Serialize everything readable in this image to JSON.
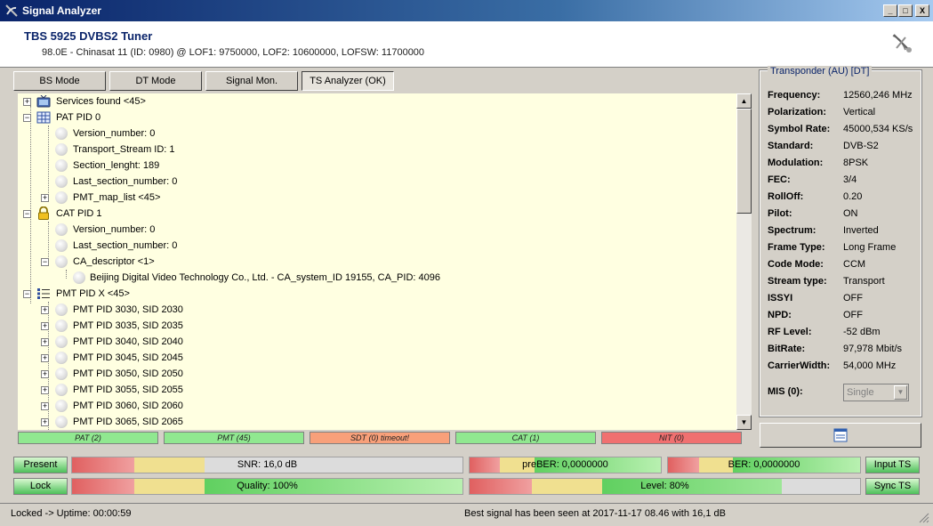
{
  "window": {
    "title": "Signal Analyzer",
    "min_glyph": "_",
    "max_glyph": "□",
    "close_glyph": "X"
  },
  "header": {
    "device": "TBS 5925 DVBS2 Tuner",
    "info": "98.0E - Chinasat 11 (ID: 0980) @ LOF1: 9750000, LOF2: 10600000, LOFSW: 11700000"
  },
  "modes": [
    {
      "label": "BS Mode"
    },
    {
      "label": "DT Mode"
    },
    {
      "label": "Signal Mon."
    },
    {
      "label": "TS Analyzer (OK)"
    }
  ],
  "tree": [
    {
      "label": "Services found <45>"
    },
    {
      "label": "PAT PID 0"
    },
    {
      "label": "Version_number: 0"
    },
    {
      "label": "Transport_Stream ID: 1"
    },
    {
      "label": "Section_lenght: 189"
    },
    {
      "label": "Last_section_number: 0"
    },
    {
      "label": "PMT_map_list <45>"
    },
    {
      "label": "CAT PID 1"
    },
    {
      "label": "Version_number: 0"
    },
    {
      "label": "Last_section_number: 0"
    },
    {
      "label": "CA_descriptor <1>"
    },
    {
      "label": "Beijing Digital Video Technology Co., Ltd. - CA_system_ID 19155, CA_PID: 4096"
    },
    {
      "label": "PMT PID X <45>"
    },
    {
      "label": "PMT PID 3030, SID 2030"
    },
    {
      "label": "PMT PID 3035, SID 2035"
    },
    {
      "label": "PMT PID 3040, SID 2040"
    },
    {
      "label": "PMT PID 3045, SID 2045"
    },
    {
      "label": "PMT PID 3050, SID 2050"
    },
    {
      "label": "PMT PID 3055, SID 2055"
    },
    {
      "label": "PMT PID 3060, SID 2060"
    },
    {
      "label": "PMT PID 3065, SID 2065"
    }
  ],
  "pid_status": [
    {
      "label": "PAT (2)",
      "color": "#90e890"
    },
    {
      "label": "PMT (45)",
      "color": "#90e890"
    },
    {
      "label": "SDT (0) timeout!",
      "color": "#f8a07a"
    },
    {
      "label": "CAT (1)",
      "color": "#90e890"
    },
    {
      "label": "NIT (0)",
      "color": "#f07070"
    }
  ],
  "transponder": {
    "title": "Transponder (AU) [DT]",
    "rows": [
      {
        "label": "Frequency:",
        "value": "12560,246 MHz"
      },
      {
        "label": "Polarization:",
        "value": "Vertical"
      },
      {
        "label": "Symbol Rate:",
        "value": "45000,534 KS/s"
      },
      {
        "label": "Standard:",
        "value": "DVB-S2"
      },
      {
        "label": "Modulation:",
        "value": "8PSK"
      },
      {
        "label": "FEC:",
        "value": "3/4"
      },
      {
        "label": "RollOff:",
        "value": "0.20"
      },
      {
        "label": "Pilot:",
        "value": "ON"
      },
      {
        "label": "Spectrum:",
        "value": "Inverted"
      },
      {
        "label": "Frame Type:",
        "value": "Long Frame"
      },
      {
        "label": "Code Mode:",
        "value": "CCM"
      },
      {
        "label": "Stream type:",
        "value": "Transport"
      },
      {
        "label": "ISSYI",
        "value": "OFF"
      },
      {
        "label": "NPD:",
        "value": "OFF"
      },
      {
        "label": "RF Level:",
        "value": "-52 dBm"
      },
      {
        "label": "BitRate:",
        "value": "97,978 Mbit/s"
      },
      {
        "label": "CarrierWidth:",
        "value": "54,000 MHz"
      }
    ],
    "mis_label": "MIS (0):",
    "mis_value": "Single"
  },
  "gauges": {
    "present": "Present",
    "lock": "Lock",
    "input_ts": "Input TS",
    "sync_ts": "Sync TS",
    "snr": {
      "label": "SNR: 16,0 dB",
      "fraction": 0.34
    },
    "preber": {
      "label": "preBER: 0,0000000",
      "fraction": 1.0
    },
    "ber": {
      "label": "BER: 0,0000000",
      "fraction": 1.0
    },
    "quality": {
      "label": "Quality: 100%",
      "fraction": 1.0
    },
    "level": {
      "label": "Level: 80%",
      "fraction": 0.8
    }
  },
  "status": {
    "left": "Locked -> Uptime: 00:00:59",
    "right": "Best signal has been seen at 2017-11-17 08.46 with 16,1 dB"
  }
}
